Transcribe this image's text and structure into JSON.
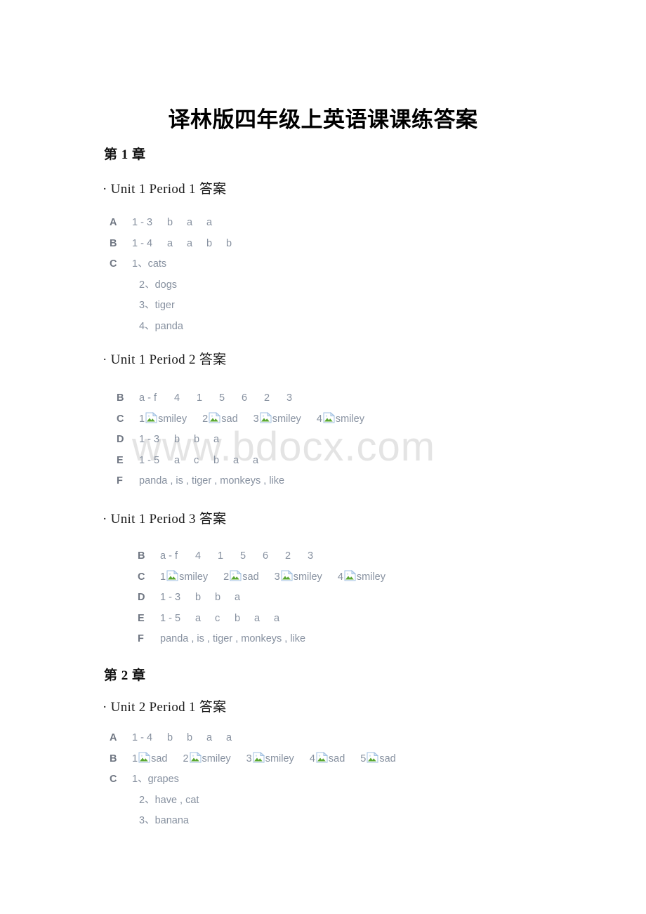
{
  "document": {
    "title": "译林版四年级上英语课课练答案",
    "watermark": "www.bdocx.com"
  },
  "chapters": [
    {
      "heading": "第 1 章",
      "sections": [
        {
          "heading": "· Unit 1 Period 1 答案",
          "rows": [
            {
              "label": "A",
              "range": "1 - 3",
              "options": [
                "b",
                "a",
                "a"
              ]
            },
            {
              "label": "B",
              "range": "1 - 4",
              "options": [
                "a",
                "a",
                "b",
                "b"
              ]
            },
            {
              "label": "C",
              "list": [
                "1、cats",
                "2、dogs",
                "3、tiger",
                "4、panda"
              ]
            }
          ]
        },
        {
          "heading": "· Unit 1 Period 2 答案",
          "rows": [
            {
              "label": "B",
              "range": "a - f",
              "options": [
                "4",
                "1",
                "5",
                "6",
                "2",
                "3"
              ]
            },
            {
              "label": "C",
              "images": [
                {
                  "index": "1",
                  "alt": "smiley"
                },
                {
                  "index": "2",
                  "alt": "sad"
                },
                {
                  "index": "3",
                  "alt": "smiley"
                },
                {
                  "index": "4",
                  "alt": "smiley"
                }
              ]
            },
            {
              "label": "D",
              "range": "1 - 3",
              "options": [
                "b",
                "b",
                "a"
              ]
            },
            {
              "label": "E",
              "range": "1 - 5",
              "options": [
                "a",
                "c",
                "b",
                "a",
                "a"
              ]
            },
            {
              "label": "F",
              "text": "panda , is , tiger , monkeys , like"
            }
          ]
        },
        {
          "heading": "· Unit 1 Period 3 答案",
          "rows": [
            {
              "label": "B",
              "range": "a - f",
              "options": [
                "4",
                "1",
                "5",
                "6",
                "2",
                "3"
              ]
            },
            {
              "label": "C",
              "images": [
                {
                  "index": "1",
                  "alt": "smiley"
                },
                {
                  "index": "2",
                  "alt": "sad"
                },
                {
                  "index": "3",
                  "alt": "smiley"
                },
                {
                  "index": "4",
                  "alt": "smiley"
                }
              ]
            },
            {
              "label": "D",
              "range": "1 - 3",
              "options": [
                "b",
                "b",
                "a"
              ]
            },
            {
              "label": "E",
              "range": "1 - 5",
              "options": [
                "a",
                "c",
                "b",
                "a",
                "a"
              ]
            },
            {
              "label": "F",
              "text": "panda , is , tiger , monkeys , like"
            }
          ]
        }
      ]
    },
    {
      "heading": "第 2 章",
      "sections": [
        {
          "heading": "· Unit 2 Period 1 答案",
          "rows": [
            {
              "label": "A",
              "range": "1 - 4",
              "options": [
                "b",
                "b",
                "a",
                "a"
              ]
            },
            {
              "label": "B",
              "images": [
                {
                  "index": "1",
                  "alt": "sad"
                },
                {
                  "index": "2",
                  "alt": "smiley"
                },
                {
                  "index": "3",
                  "alt": "smiley"
                },
                {
                  "index": "4",
                  "alt": "sad"
                },
                {
                  "index": "5",
                  "alt": "sad"
                }
              ]
            },
            {
              "label": "C",
              "list": [
                "1、grapes",
                "2、have , cat",
                "3、banana"
              ]
            }
          ]
        }
      ]
    }
  ],
  "colors": {
    "answer_text": "#8791a0",
    "answer_label": "#6f7682",
    "heading_text": "#111111",
    "watermark": "#e4e4e4",
    "icon_border": "#a8c4e0",
    "icon_green": "#5aa832"
  }
}
